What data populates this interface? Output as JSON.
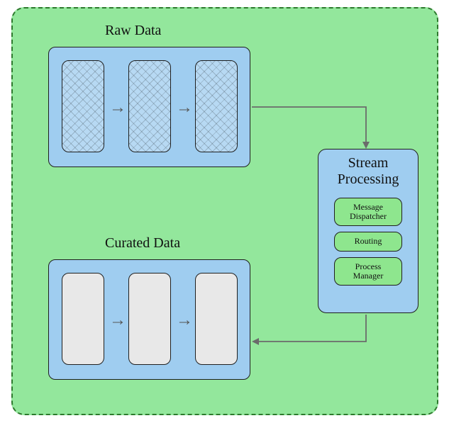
{
  "raw": {
    "title": "Raw Data"
  },
  "curated": {
    "title": "Curated Data"
  },
  "stream": {
    "title_l1": "Stream",
    "title_l2": "Processing",
    "items": [
      {
        "label_l1": "Message",
        "label_l2": "Dispatcher"
      },
      {
        "label_l1": "Routing",
        "label_l2": ""
      },
      {
        "label_l1": "Process",
        "label_l2": "Manager"
      }
    ]
  },
  "glyphs": {
    "arrow_right": "→"
  }
}
